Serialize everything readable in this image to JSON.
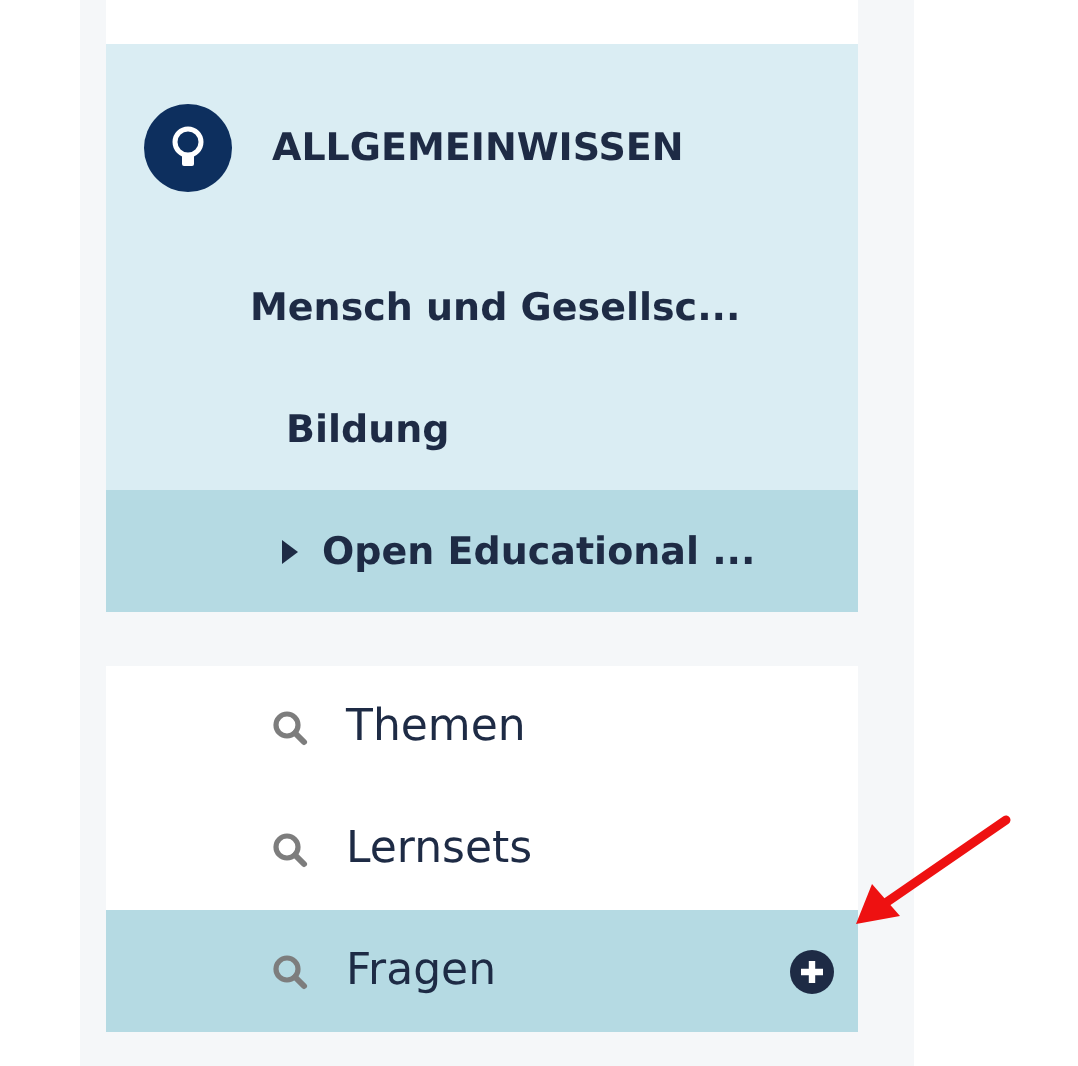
{
  "category": {
    "title": "ALLGEMEINWISSEN",
    "items": [
      {
        "label": "Mensch und Gesellsc...",
        "selected": false,
        "children": [
          {
            "label": "Bildung",
            "selected": false,
            "children": [
              {
                "label": "Open Educational ...",
                "selected": true
              }
            ]
          }
        ]
      }
    ]
  },
  "views": [
    {
      "label": "Themen",
      "selected": false
    },
    {
      "label": "Lernsets",
      "selected": false
    },
    {
      "label": "Fragen",
      "selected": true
    }
  ]
}
